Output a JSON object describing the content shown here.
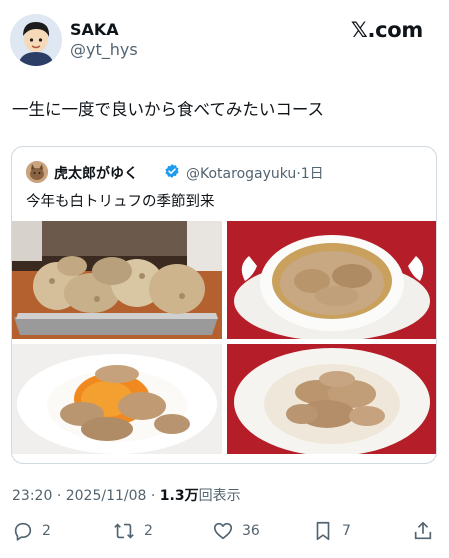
{
  "author": {
    "name": "SAKA",
    "handle": "@yt_hys"
  },
  "brand": "𝕏.com",
  "post": {
    "text": "一生に一度で良いから食べてみたいコース"
  },
  "quote": {
    "name": "虎太郎がゆく",
    "handle": "@Kotarogayuku",
    "time": "1日",
    "separator": "·",
    "text": "今年も白トリュフの季節到来"
  },
  "meta": {
    "time": "23:20",
    "date": "2025/11/08",
    "separator": "·",
    "views_count": "1.3万",
    "views_label": "回表示"
  },
  "actions": {
    "replies": "2",
    "reposts": "2",
    "likes": "36",
    "bookmarks": "7"
  },
  "icons": [
    "avatar",
    "x-logo",
    "verified-badge",
    "reply-icon",
    "repost-icon",
    "like-icon",
    "bookmark-icon",
    "share-icon"
  ],
  "colors": {
    "text": "#0f1419",
    "secondary": "#536471",
    "verified": "#1d9bf0",
    "border": "#cfd9de"
  }
}
